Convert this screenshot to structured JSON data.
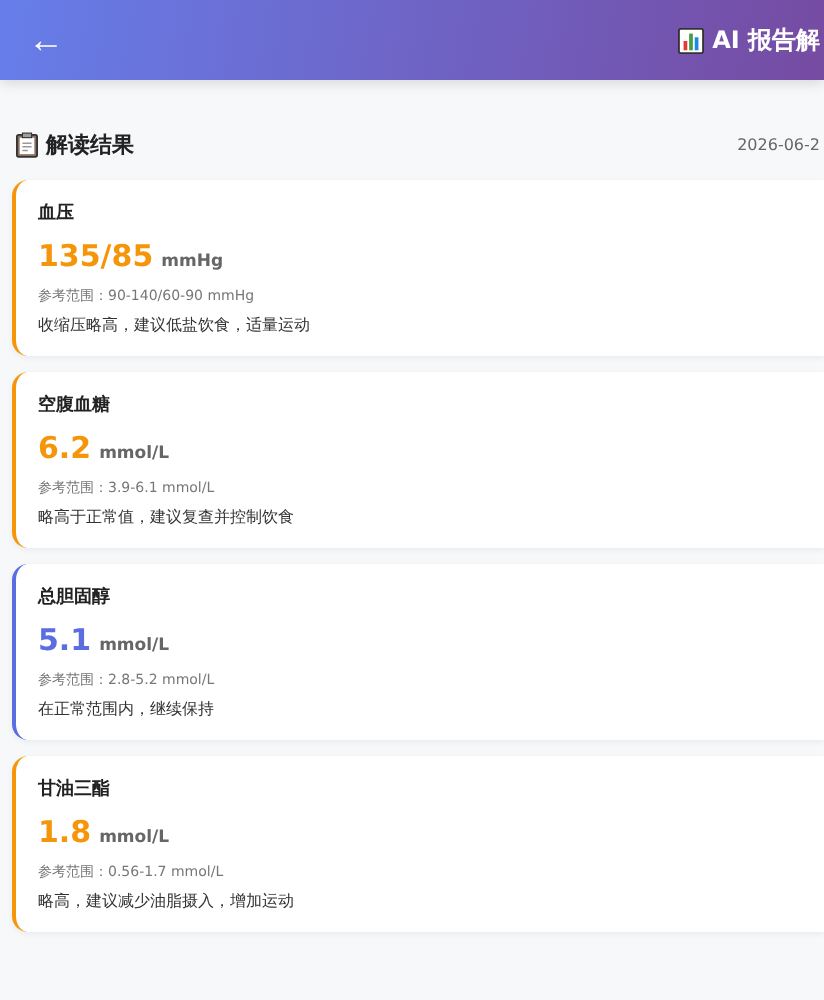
{
  "header": {
    "back": "←",
    "title": "AI 报告解"
  },
  "section": {
    "title": "解读结果",
    "date": "2026-06-2"
  },
  "results": [
    {
      "name": "血压",
      "value": "135/85",
      "unit": "mmHg",
      "range": "参考范围：90-140/60-90 mmHg",
      "advice": "收缩压略高，建议低盐饮食，适量运动",
      "color": "#f5960a"
    },
    {
      "name": "空腹血糖",
      "value": "6.2",
      "unit": "mmol/L",
      "range": "参考范围：3.9-6.1 mmol/L",
      "advice": "略高于正常值，建议复查并控制饮食",
      "color": "#f5960a"
    },
    {
      "name": "总胆固醇",
      "value": "5.1",
      "unit": "mmol/L",
      "range": "参考范围：2.8-5.2 mmol/L",
      "advice": "在正常范围内，继续保持",
      "color": "#5b6ee1"
    },
    {
      "name": "甘油三酯",
      "value": "1.8",
      "unit": "mmol/L",
      "range": "参考范围：0.56-1.7 mmol/L",
      "advice": "略高，建议减少油脂摄入，增加运动",
      "color": "#f5960a"
    }
  ]
}
